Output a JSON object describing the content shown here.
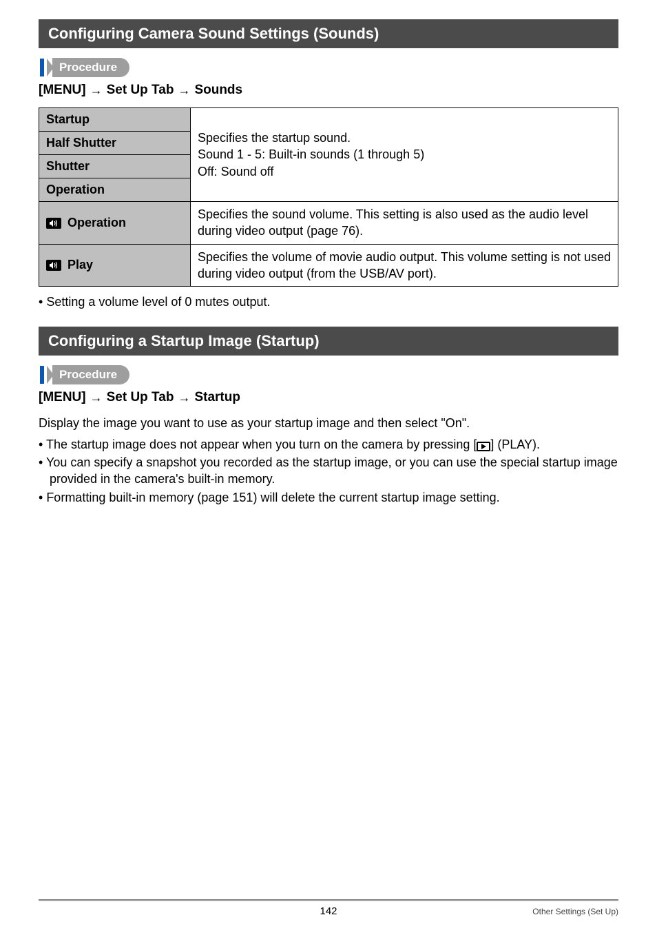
{
  "section1": {
    "title": "Configuring Camera Sound Settings (Sounds)",
    "procedure_label": "Procedure",
    "menu_path": {
      "a": "[MENU]",
      "b": "Set Up Tab",
      "c": "Sounds"
    },
    "table": {
      "rows": {
        "startup": "Startup",
        "half_shutter": "Half Shutter",
        "shutter": "Shutter",
        "operation": "Operation",
        "vol_operation": "Operation",
        "vol_play": "Play"
      },
      "shared_desc_line1": "Specifies the startup sound.",
      "shared_desc_line2": "Sound 1 - 5: Built-in sounds (1 through 5)",
      "shared_desc_line3": "Off: Sound off",
      "vol_operation_desc": "Specifies the sound volume. This setting is also used as the audio level during video output (page 76).",
      "vol_play_desc": "Specifies the volume of movie audio output. This volume setting is not used during video output (from the USB/AV port)."
    },
    "note": "Setting a volume level of 0 mutes output."
  },
  "section2": {
    "title": "Configuring a Startup Image (Startup)",
    "procedure_label": "Procedure",
    "menu_path": {
      "a": "[MENU]",
      "b": "Set Up Tab",
      "c": "Startup"
    },
    "intro": "Display the image you want to use as your startup image and then select \"On\".",
    "bullets": {
      "b1a": "The startup image does not appear when you turn on the camera by pressing [",
      "b1b": "] (PLAY).",
      "b2": "You can specify a snapshot you recorded as the startup image, or you can use the special startup image provided in the camera's built-in memory.",
      "b3": "Formatting built-in memory (page 151) will delete the current startup image setting."
    }
  },
  "footer": {
    "page": "142",
    "label": "Other Settings (Set Up)"
  },
  "glyphs": {
    "arrow": "→",
    "speaker": "🔊"
  }
}
